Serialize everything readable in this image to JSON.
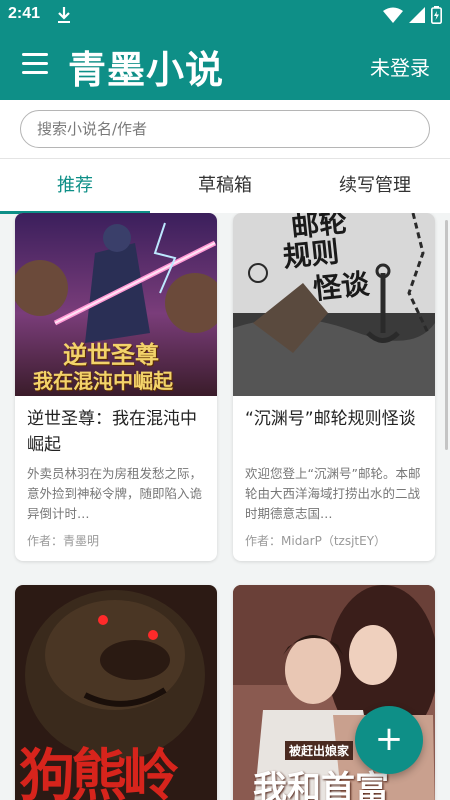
{
  "status_bar": {
    "time": "2:41"
  },
  "app_bar": {
    "title": "青墨小说",
    "login_label": "未登录"
  },
  "search": {
    "placeholder": "搜索小说名/作者"
  },
  "tabs": [
    {
      "label": "推荐",
      "active": true
    },
    {
      "label": "草稿箱",
      "active": false
    },
    {
      "label": "续写管理",
      "active": false
    }
  ],
  "novels": [
    {
      "title": "逆世圣尊：我在混沌中崛起",
      "description": "外卖员林羽在为房租发愁之际，意外捡到神秘令牌，随即陷入诡异倒计时…",
      "author": "作者：青墨明",
      "cover_text": [
        "逆世圣尊",
        "我在混沌中崛起"
      ]
    },
    {
      "title": "“沉渊号”邮轮规则怪谈",
      "description": "欢迎您登上“沉渊号”邮轮。本邮轮由大西洋海域打捞出水的二战时期德意志国…",
      "author": "作者：MidarP（tzsjtEY）",
      "cover_text": [
        "邮轮",
        "规则",
        "怪谈"
      ]
    },
    {
      "title": "",
      "description": "",
      "author": "",
      "cover_text": [
        "狗熊岭"
      ]
    },
    {
      "title": "",
      "description": "",
      "author": "",
      "cover_text": [
        "被赶出娘家",
        "我和首富"
      ]
    }
  ],
  "fab": {
    "label": "+"
  },
  "colors": {
    "primary": "#0e8f87",
    "background": "#f2f4f4"
  }
}
